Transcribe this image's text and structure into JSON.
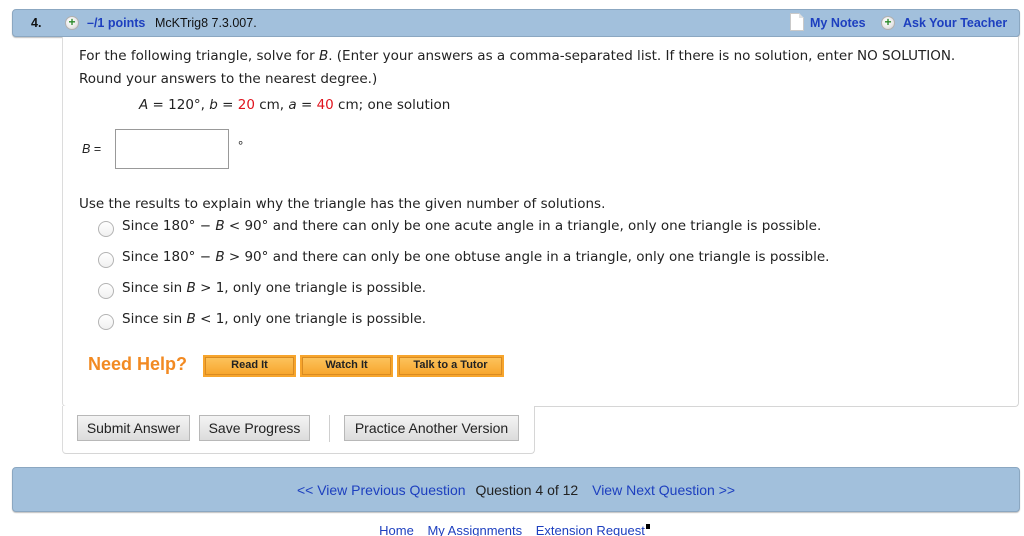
{
  "header": {
    "question_number": "4.",
    "points": "–/1 points",
    "problem_code": "McKTrig8 7.3.007.",
    "my_notes": "My Notes",
    "ask_teacher": "Ask Your Teacher",
    "icons": {
      "expand": "plus-circle-icon",
      "notes": "note-page-icon",
      "ask": "plus-circle-icon"
    }
  },
  "question": {
    "prompt_line1_pre": "For the following triangle, solve for ",
    "prompt_var": "B",
    "prompt_line1_post": ". (Enter your answers as a comma-separated list. If there is no solution, enter NO SOLUTION. Round your answers to the nearest degree.)",
    "given": {
      "A_label": "A",
      "A_value": " = 120°, ",
      "b_label": "b",
      "b_eq": " = ",
      "b_value": "20",
      "b_unit": " cm, ",
      "a_label": "a",
      "a_eq": " = ",
      "a_value": "40",
      "a_unit": " cm; one solution"
    },
    "answer_label_var": "B",
    "answer_label_eq": " =",
    "answer_value": "",
    "answer_unit": "°"
  },
  "explain": {
    "prompt": "Use the results to explain why the triangle has the given number of solutions.",
    "options": [
      {
        "pre": "Since 180° − ",
        "var": "B",
        "post": " < 90° and there can only be one acute angle in a triangle, only one triangle is possible.",
        "selected": false
      },
      {
        "pre": "Since 180° − ",
        "var": "B",
        "post": " > 90° and there can only be one obtuse angle in a triangle, only one triangle is possible.",
        "selected": false
      },
      {
        "pre": "Since sin ",
        "var": "B",
        "post": " > 1, only one triangle is possible.",
        "selected": false
      },
      {
        "pre": "Since sin ",
        "var": "B",
        "post": " < 1, only one triangle is possible.",
        "selected": false
      }
    ]
  },
  "help": {
    "label": "Need Help?",
    "read_it": "Read It",
    "watch_it": "Watch It",
    "tutor": "Talk to a Tutor"
  },
  "actions": {
    "submit": "Submit Answer",
    "save": "Save Progress",
    "practice": "Practice Another Version"
  },
  "nav": {
    "previous": "<< View Previous Question",
    "count": "Question 4 of 12",
    "next": "View Next Question >>"
  },
  "footer": {
    "home": "Home",
    "assignments": "My Assignments",
    "extension": "Extension Request"
  },
  "colors": {
    "header_bg": "#a2c0dc",
    "link": "#1d3fbf",
    "highlight_value": "#e0141e",
    "help_orange": "#f28a22"
  }
}
